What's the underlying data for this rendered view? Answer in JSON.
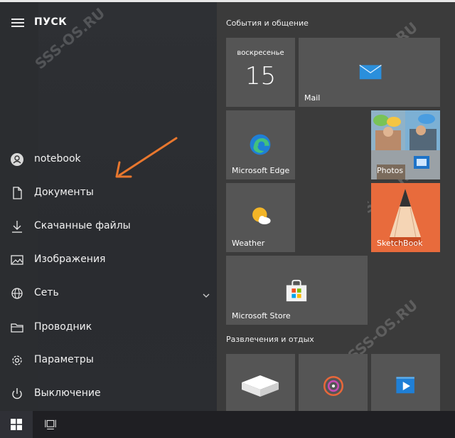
{
  "start_menu": {
    "title": "ПУСК",
    "nav_items": [
      {
        "label": "notebook",
        "icon": "user-avatar-icon"
      },
      {
        "label": "Документы",
        "icon": "document-icon"
      },
      {
        "label": "Скачанные файлы",
        "icon": "download-icon"
      },
      {
        "label": "Изображения",
        "icon": "pictures-icon"
      },
      {
        "label": "Сеть",
        "icon": "network-globe-icon"
      },
      {
        "label": "Проводник",
        "icon": "file-explorer-icon"
      },
      {
        "label": "Параметры",
        "icon": "gear-icon"
      },
      {
        "label": "Выключение",
        "icon": "power-icon"
      }
    ]
  },
  "tile_groups": [
    {
      "title": "События и общение"
    },
    {
      "title": "Развлечения и отдых"
    }
  ],
  "tiles": {
    "calendar": {
      "day": "воскресенье",
      "date": "15"
    },
    "mail": {
      "label": "Mail"
    },
    "edge": {
      "label": "Microsoft Edge"
    },
    "photos": {
      "label": "Photos"
    },
    "weather": {
      "label": "Weather"
    },
    "sketchbook": {
      "label": "SketchBook"
    },
    "store": {
      "label": "Microsoft Store"
    }
  },
  "watermark": "SSS-OS.RU",
  "colors": {
    "accent_orange": "#e8772e",
    "tile_gray": "#555555",
    "pane_dark": "#2b2d30",
    "edge_blue": "#1f7fd6",
    "mail_blue": "#2a8fdc",
    "weather_yellow": "#f3b527",
    "sketchbook_orange": "#e8673a"
  }
}
